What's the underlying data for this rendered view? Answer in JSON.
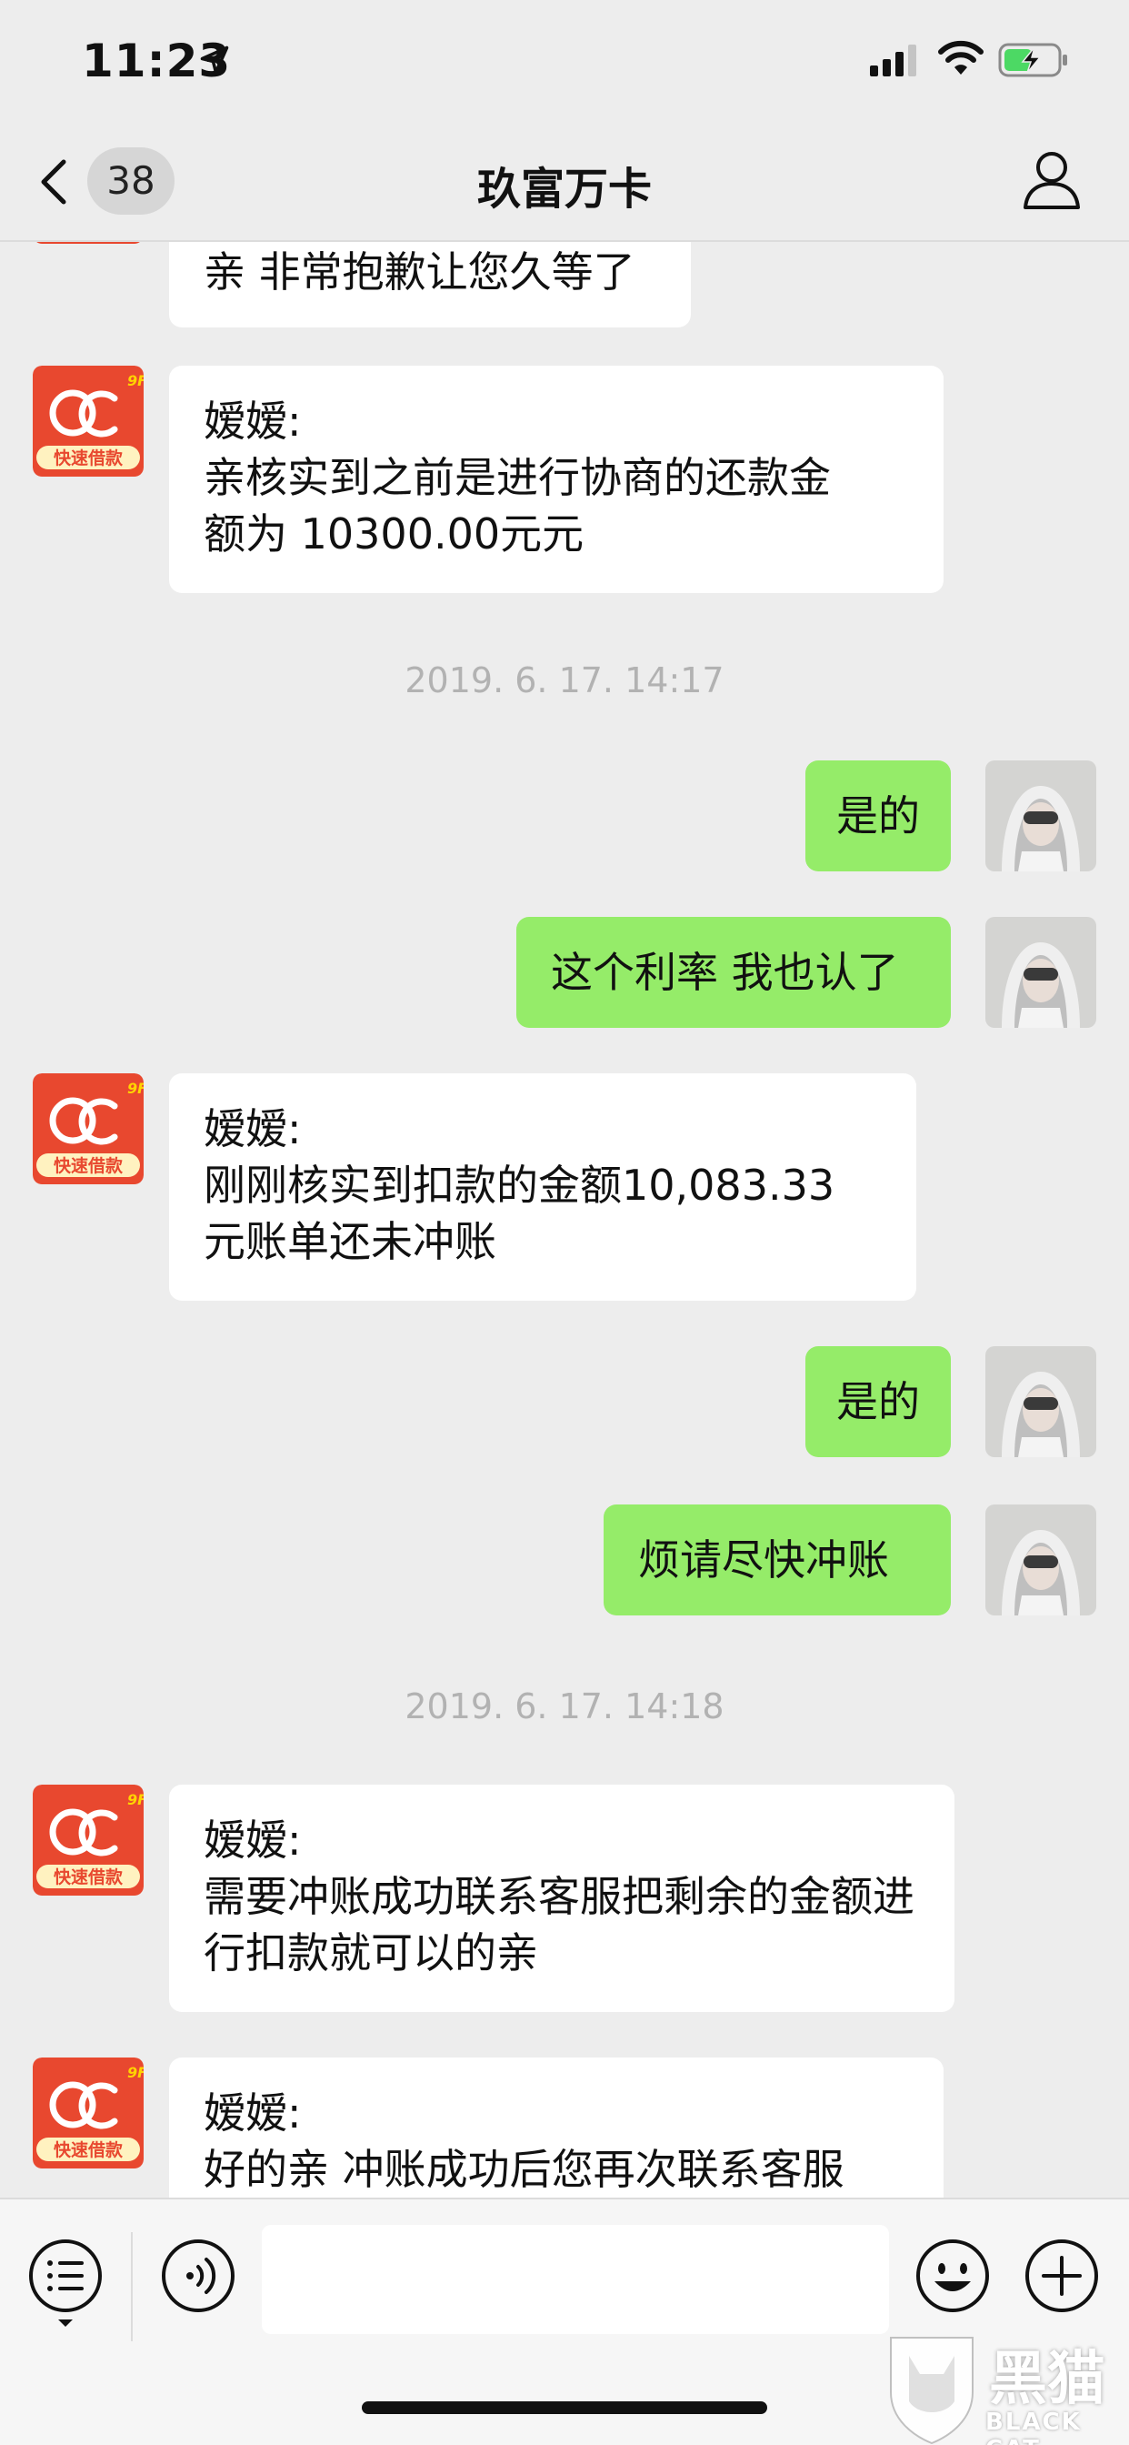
{
  "status_bar": {
    "time": "11:23"
  },
  "nav": {
    "unread_count": "38",
    "title": "玖富万卡"
  },
  "contact_avatar": {
    "logo_text": "快速借款",
    "brand_color": "#e8482f"
  },
  "messages": [
    {
      "type": "incoming",
      "text": "亲  非常抱歉让您久等了"
    },
    {
      "type": "incoming",
      "sender": "嫒嫒:",
      "lines": [
        "亲核实到之前是进行协商的还款金",
        "额为 10300.00元元"
      ]
    },
    {
      "type": "timestamp",
      "text": "2019. 6. 17. 14:17"
    },
    {
      "type": "outgoing",
      "text": "是的"
    },
    {
      "type": "outgoing",
      "text": "这个利率 我也认了"
    },
    {
      "type": "incoming",
      "sender": "嫒嫒:",
      "lines": [
        "刚刚核实到扣款的金额10,083.33",
        "元账单还未冲账"
      ]
    },
    {
      "type": "outgoing",
      "text": "是的"
    },
    {
      "type": "outgoing",
      "text": "烦请尽快冲账"
    },
    {
      "type": "timestamp",
      "text": "2019. 6. 17. 14:18"
    },
    {
      "type": "incoming",
      "sender": "嫒嫒:",
      "lines": [
        "需要冲账成功联系客服把剩余的金额进",
        "行扣款就可以的亲"
      ]
    },
    {
      "type": "incoming",
      "sender": "嫒嫒:",
      "lines": [
        "好的亲 冲账成功后您再次联系客服"
      ]
    }
  ],
  "input_bar": {
    "placeholder": ""
  },
  "watermark": {
    "cn": "黑猫",
    "en": "BLACK CAT"
  },
  "colors": {
    "background": "#ededed",
    "outgoing_bubble": "#95ec69",
    "incoming_bubble": "#ffffff"
  }
}
